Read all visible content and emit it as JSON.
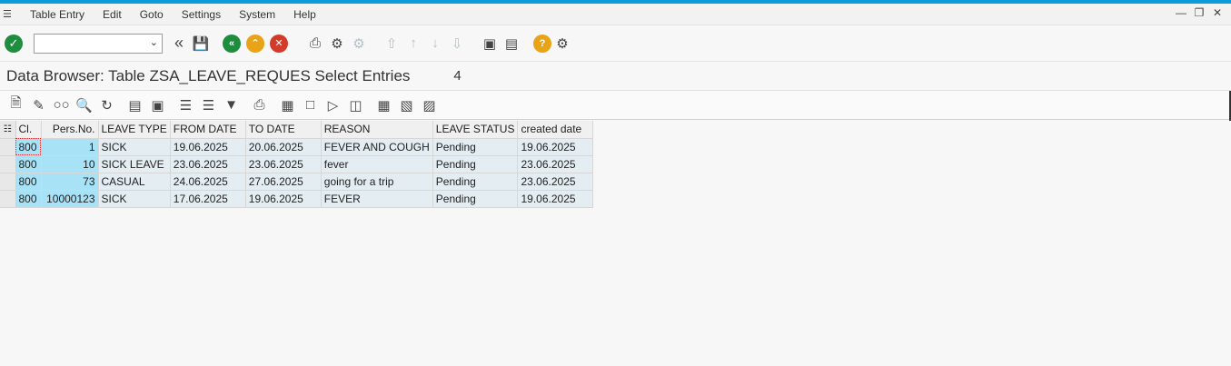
{
  "menubar": {
    "items": [
      "Table Entry",
      "Edit",
      "Goto",
      "Settings",
      "System",
      "Help"
    ]
  },
  "toolbar": {
    "command_field_value": "",
    "icons": [
      "check-icon",
      "chevron-left-double-icon",
      "save-icon",
      "back-icon",
      "exit-icon",
      "cancel-icon",
      "print-icon",
      "find-icon",
      "find-next-icon",
      "first-page-icon",
      "previous-page-icon",
      "next-page-icon",
      "last-page-icon",
      "new-session-icon",
      "shortcut-icon",
      "help-icon",
      "customize-icon"
    ]
  },
  "page": {
    "title": "Data Browser: Table ZSA_LEAVE_REQUES Select Entries",
    "entry_count": "4"
  },
  "table": {
    "headers": [
      "Cl.",
      "Pers.No.",
      "LEAVE TYPE",
      "FROM DATE",
      "TO DATE",
      "REASON",
      "LEAVE STATUS",
      "created date"
    ],
    "rows": [
      [
        "800",
        "1",
        "SICK",
        "19.06.2025",
        "20.06.2025",
        "FEVER AND COUGH",
        "Pending",
        "19.06.2025"
      ],
      [
        "800",
        "10",
        "SICK LEAVE",
        "23.06.2025",
        "23.06.2025",
        "fever",
        "Pending",
        "23.06.2025"
      ],
      [
        "800",
        "73",
        "CASUAL",
        "24.06.2025",
        "27.06.2025",
        "going for a trip",
        "Pending",
        "23.06.2025"
      ],
      [
        "800",
        "10000123",
        "SICK",
        "17.06.2025",
        "19.06.2025",
        "FEVER",
        "Pending",
        "19.06.2025"
      ]
    ]
  },
  "colors": {
    "accent_bar": "#0a9bd8",
    "key_cell": "#a8e2f6",
    "value_cell": "#e3edf2",
    "ok_green": "#1e8e3e",
    "cancel_red": "#d23a2a",
    "amber": "#e8a317"
  }
}
